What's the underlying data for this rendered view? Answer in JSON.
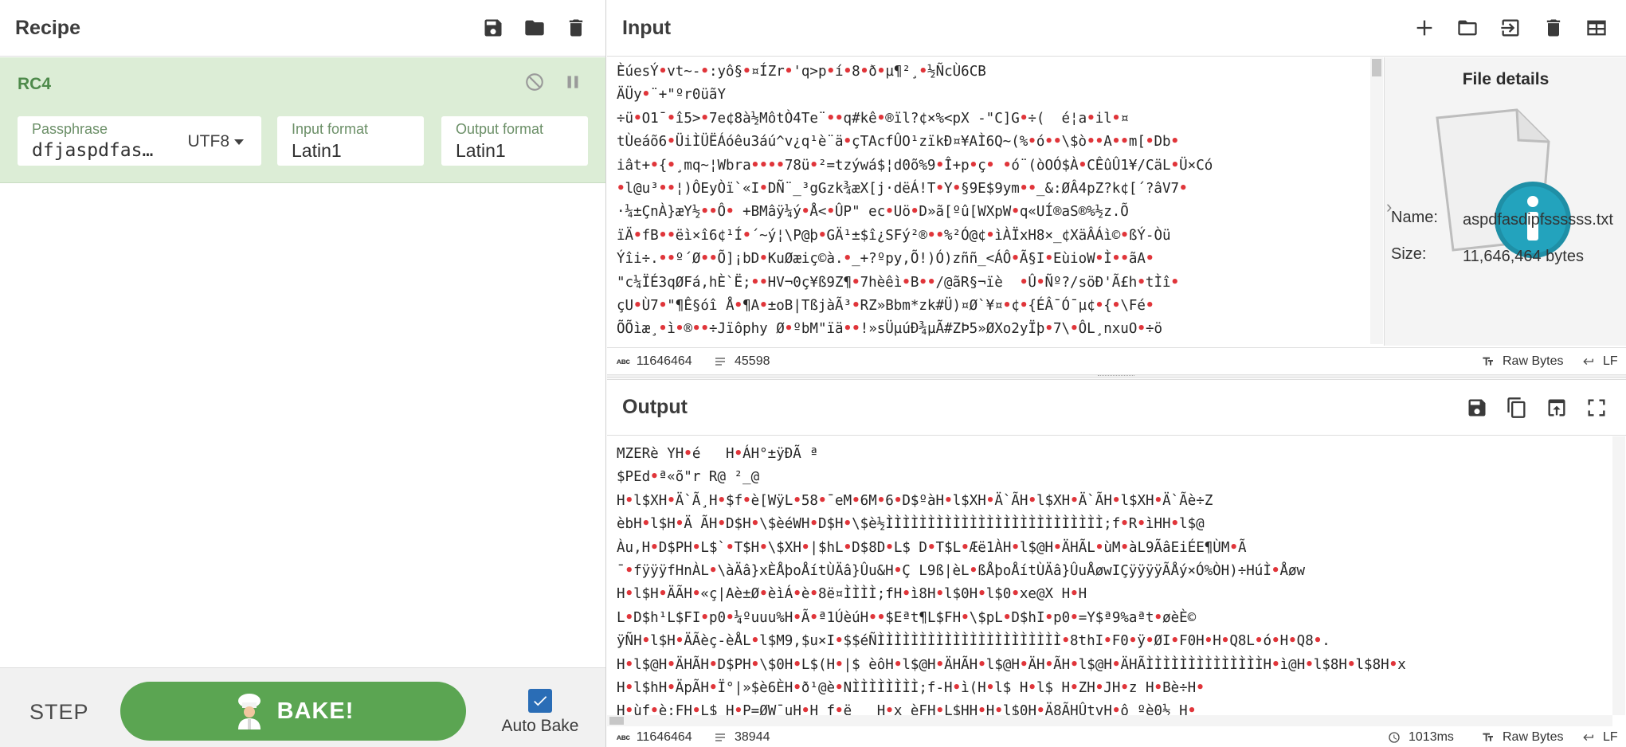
{
  "recipe": {
    "title": "Recipe",
    "operation": {
      "name": "RC4",
      "passphrase_label": "Passphrase",
      "passphrase_value": "dfjaspdfas…",
      "passphrase_encoding": "UTF8",
      "input_format_label": "Input format",
      "input_format_value": "Latin1",
      "output_format_label": "Output format",
      "output_format_value": "Latin1"
    },
    "footer": {
      "step_label": "STEP",
      "bake_label": "BAKE!",
      "auto_bake_label": "Auto Bake",
      "auto_bake_checked": true
    }
  },
  "input": {
    "title": "Input",
    "lines": [
      "ÈúesÝ•vt~-•:yô§•¤ÍZr•'q>p•í•8•ð•µ¶²¸•½ÑcÙ6CB",
      "ÄÜy•¨+\"ºr0üãY",
      "÷ü•O1¯•î5>•7e¢8à½MôtÒ4Te¨••q#kê•®ïl?¢×%<pX -\"C]G•÷(  é¦a•il•¤",
      "tÙeáõ6•ÜiÌÜËÁóêu3áú^v¿q¹è¨ä•çTAcfÛO¹zïkÐ¤¥AÌ6Q~(%•ó••\\$ò••A••m[•Db•",
      "iât+•{•¸mq~¦Wbra••••78ü•²=tzýwá$¦d0õ%9•Î+p•ç• •ó¨(òOÓ$À•CÊûÛ1¥/CäL•Ü×Có",
      "•l@u³••¦)ÔEyÒï`«I•DÑ¨_³gGzk¾æX[j·dëÁ!T•Y•§9E$9ym••_&:ØÂ4pZ?k¢[´?âV7•",
      "·¼±ÇnÀ}æY½••Ô• +BMâÿ¼ý•Å<•ÛP\" ec•Uö•D»ã[ºû[WXpW•q«UÍ®aS®%½z.Õ",
      "ïÄ•fB••ëì×î6¢¹Í•´~ý¦\\P@þ•GÄ¹±$î¿SFý²®••%²Ó@¢•ìÀÏxH8×_¢XäÂÁì©•ßÝ-Òü",
      "Ýîi÷.••º´Ø••Õ]¡bD•KuØæiç©à.•_+?ºpy,Õ!)Ó)zññ_<ÁÔ•Ã§I•EùioW•Ì••ãA•",
      "\"c¼ÏÉ3qØFá,hÈ`Ë;••HV¬0ç¥ß9Z¶•7hèêì•B••/@ãR§¬ïè  •Û•Ñº?/söÐ'Ã£h•tÌî•",
      "çU•Ù7•\"¶Ê§óî Å•¶A•±oB|TßjàÃ³•RZ»Bbm*zk#Ü)¤Ø`¥¤•¢•{ÉÂ¯Ó¯µ¢•{•\\Fé•",
      "ÕÕìæ¸•ì•®••÷Jïôphy Ø•ºbM\"ïä••!»sÜµúÐ¾µÃ#ZÞ5»ØXo2yÏþ•7\\•ÔL¸nxuO•÷ö"
    ],
    "status": {
      "length": "11646464",
      "lines": "45598",
      "encoding": "Raw Bytes",
      "eol": "LF"
    }
  },
  "file_details": {
    "title": "File details",
    "name_label": "Name:",
    "name_value": "aspdfasdipfssssss.txt",
    "size_label": "Size:",
    "size_value": "11,646,464 bytes"
  },
  "output": {
    "title": "Output",
    "lines": [
      "MZERè YH•é   H•ÁH°±ÿÐÃ ª",
      "$PEd•ª«õ\"r R@ ²_@",
      "H•l$XH•Ä`Ã¸H•$f•è[WÿL•58•¯eM•6M•6•D$ºàH•l$XH•Ä`ÃH•l$XH•Ä`ÃH•l$XH•Ä`Ãè÷Z",
      "èbH•l$H•Ä ÃH•D$H•\\$èéWH•D$H•\\$è½ÌÌÌÌÌÌÌÌÌÌÌÌÌÌÌÌÌÌÌÌÌÌÌÌÌÌ;f•R•ìHH•l$@",
      "Àu,H•D$PH•L$`•T$H•\\$XH•|$hL•D$8D•L$ D•T$L•Æë1ÀH•l$@H•ÄHÃL•ùM•àL9ÃâEiÉE¶ÙM•Ã",
      "¯•fÿÿÿfHnÀL•\\àÄâ}xÈÅþoÅítÙÄâ}Ûu&H•Ç L9ß|èL•ßÅþoÅítÙÄâ}ÛuÅøwIÇÿÿÿÿÃÅý×Ó%ÒH)÷HúÌ•Åøw",
      "H•l$H•ÄÃH•«ç|Aè±Ø•èìÁ•è•8ë¤ÌÌÌÌ;fH•ì8H•l$0H•l$0•xe@X H•H",
      "L•D$h¹L$FI•p0•¼ºuuu%H•Ã•ª1ÚèúH••$Eªt¶L$FH•\\$pL•D$hI•p0•=Y$ª9%aªt•øèÈ©",
      "ÿÑH•l$H•ÄÃèç-èÅL•l$M9,$u×I•$$éÑÌÌÌÌÌÌÌÌÌÌÌÌÌÌÌÌÌÌÌÌÌÌ•8thI•F0•ÿ•ØI•F0H•H•Q8L•ó•H•Q8•.",
      "H•l$@H•ÄHÃH•D$PH•\\$0H•L$(H•|$ èôH•l$@H•ÄHÃH•l$@H•ÄH•ÃH•l$@H•ÄHÃÌÌÌÌÌÌÌÌÌÌÌÌÌÌH•ì@H•l$8H•l$8H•x",
      "H•l$hH•ÄpÃH•Ï°|»$è6ÈH•ð¹@è•NÌÌÌÌÌÌÌÌ;f-H•ì(H•l$ H•l$ H•ZH•JH•z H•Bè÷H•",
      "H•ùf•è;FH•L$ H•P=ØW¯uH•H f•ë   H•x èFH•L$HH•H•l$0H•Ä8ÃHÛtvH•ô ºè0½ H•"
    ],
    "status": {
      "length": "11646464",
      "lines": "38944",
      "time": "1013ms",
      "encoding": "Raw Bytes",
      "eol": "LF"
    }
  }
}
